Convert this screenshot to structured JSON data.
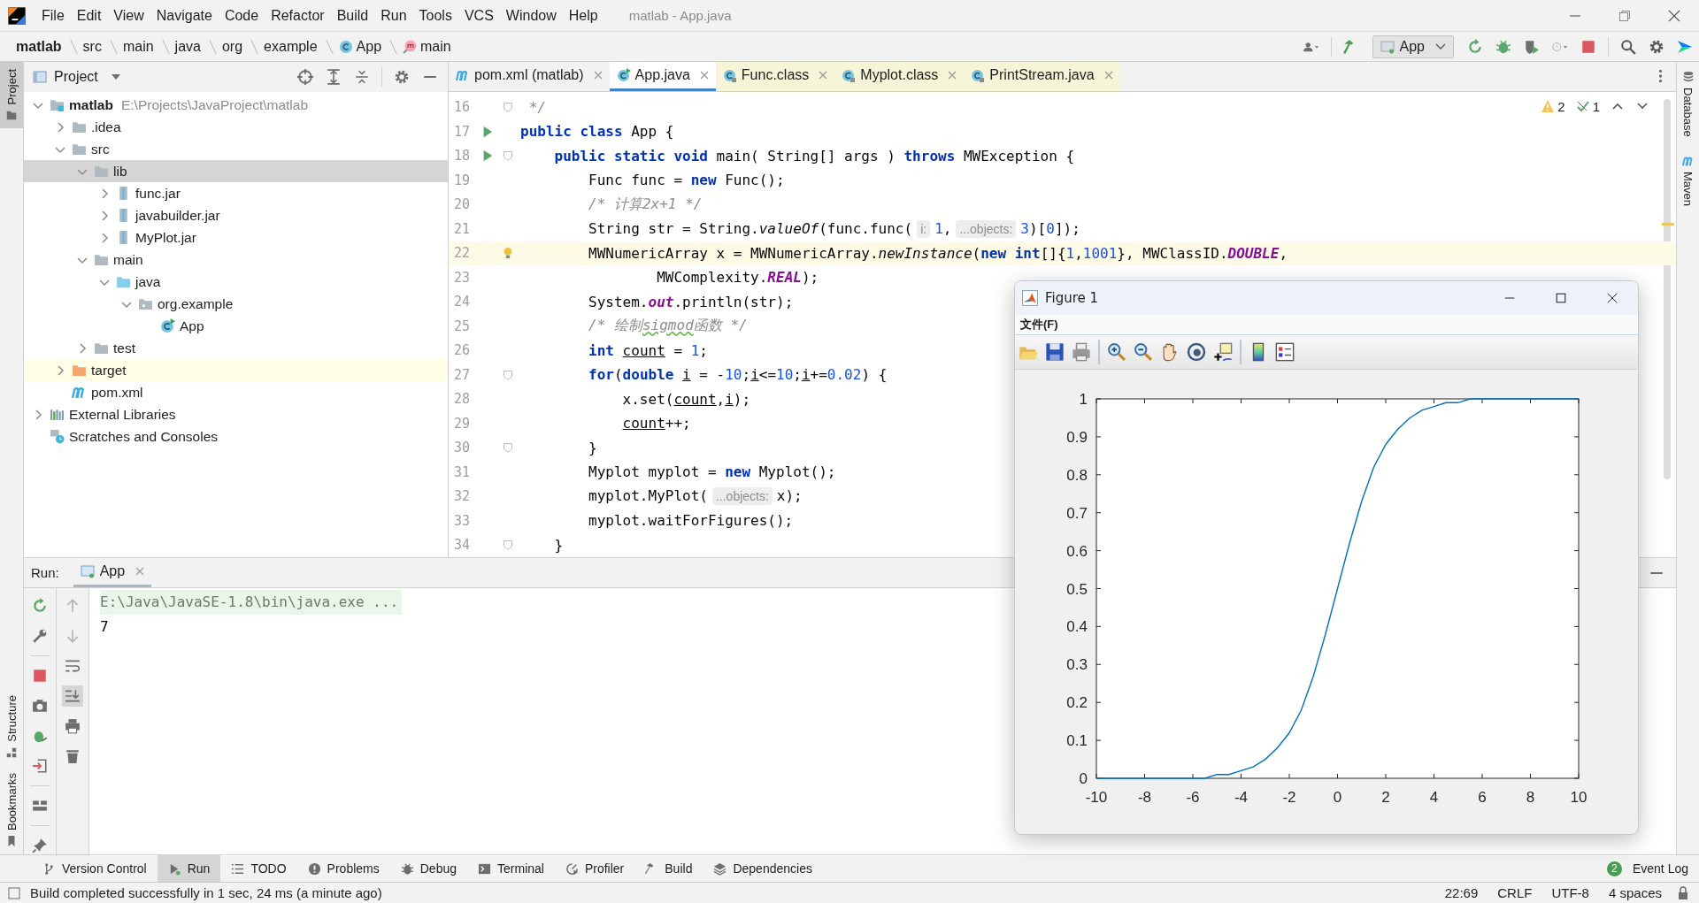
{
  "window": {
    "title": "matlab - App.java"
  },
  "menu": [
    "File",
    "Edit",
    "View",
    "Navigate",
    "Code",
    "Refactor",
    "Build",
    "Run",
    "Tools",
    "VCS",
    "Window",
    "Help"
  ],
  "breadcrumbs": [
    {
      "label": "matlab",
      "kind": "project"
    },
    {
      "label": "src",
      "kind": "folder"
    },
    {
      "label": "main",
      "kind": "folder"
    },
    {
      "label": "java",
      "kind": "folder"
    },
    {
      "label": "org",
      "kind": "folder"
    },
    {
      "label": "example",
      "kind": "folder"
    },
    {
      "label": "App",
      "kind": "class"
    },
    {
      "label": "main",
      "kind": "method"
    }
  ],
  "run_config": {
    "label": "App"
  },
  "left_strip": {
    "top": [
      {
        "label": "Project",
        "kind": "project",
        "selected": true
      }
    ],
    "bottom": [
      {
        "label": "Structure",
        "kind": "structure",
        "selected": false
      },
      {
        "label": "Bookmarks",
        "kind": "bookmarks",
        "selected": false
      }
    ]
  },
  "right_strip": [
    {
      "label": "Database",
      "kind": "database"
    },
    {
      "label": "Maven",
      "kind": "maven"
    }
  ],
  "project": {
    "title": "Project",
    "tree": [
      {
        "label": "matlab",
        "path": "E:\\Projects\\JavaProject\\matlab",
        "kind": "module",
        "expanded": true,
        "selected": false,
        "children": [
          {
            "label": ".idea",
            "kind": "folder",
            "expanded": false,
            "selected": false
          },
          {
            "label": "src",
            "kind": "folder",
            "expanded": true,
            "selected": false,
            "children": [
              {
                "label": "lib",
                "kind": "folder",
                "expanded": true,
                "selected": true,
                "children": [
                  {
                    "label": "func.jar",
                    "kind": "jar",
                    "expanded": false,
                    "selected": false
                  },
                  {
                    "label": "javabuilder.jar",
                    "kind": "jar",
                    "expanded": false,
                    "selected": false
                  },
                  {
                    "label": "MyPlot.jar",
                    "kind": "jar",
                    "expanded": false,
                    "selected": false
                  }
                ]
              },
              {
                "label": "main",
                "kind": "folder",
                "expanded": true,
                "selected": false,
                "children": [
                  {
                    "label": "java",
                    "kind": "source-folder",
                    "expanded": true,
                    "selected": false,
                    "children": [
                      {
                        "label": "org.example",
                        "kind": "package",
                        "expanded": true,
                        "selected": false,
                        "children": [
                          {
                            "label": "App",
                            "kind": "runnable-class",
                            "selected": false
                          }
                        ]
                      }
                    ]
                  }
                ]
              },
              {
                "label": "test",
                "kind": "folder",
                "expanded": false,
                "selected": false
              }
            ]
          },
          {
            "label": "target",
            "kind": "excluded-folder",
            "expanded": false,
            "selected": false
          },
          {
            "label": "pom.xml",
            "kind": "maven",
            "selected": false
          }
        ]
      },
      {
        "label": "External Libraries",
        "kind": "libraries",
        "expanded": false,
        "selected": false
      },
      {
        "label": "Scratches and Consoles",
        "kind": "scratches",
        "selected": false
      }
    ]
  },
  "editor": {
    "tabs": [
      {
        "label": "pom.xml (matlab)",
        "kind": "maven",
        "selected": false
      },
      {
        "label": "App.java",
        "kind": "project-class",
        "selected": true
      },
      {
        "label": "Func.class",
        "kind": "library-class",
        "selected": false
      },
      {
        "label": "Myplot.class",
        "kind": "library-class",
        "selected": false
      },
      {
        "label": "PrintStream.java",
        "kind": "library-class",
        "selected": false
      }
    ],
    "inspections": {
      "warnings": "2",
      "weak_warnings": "1"
    },
    "lines": [
      {
        "number": "16",
        "run": false,
        "fold": true,
        "bulb": false,
        "highlighted": false,
        "tokens": [
          {
            "kind": "comment",
            "text": " */"
          }
        ]
      },
      {
        "number": "17",
        "run": true,
        "fold": false,
        "bulb": false,
        "highlighted": false,
        "tokens": [
          {
            "kind": "keyword",
            "text": "public class"
          },
          {
            "kind": "plain",
            "text": " App {"
          }
        ]
      },
      {
        "number": "18",
        "run": true,
        "fold": true,
        "bulb": false,
        "highlighted": false,
        "tokens": [
          {
            "kind": "keyword",
            "text": "    public static void"
          },
          {
            "kind": "plain",
            "text": " main( String[] args ) "
          },
          {
            "kind": "keyword",
            "text": "throws"
          },
          {
            "kind": "plain",
            "text": " MWException {"
          }
        ]
      },
      {
        "number": "19",
        "run": false,
        "fold": false,
        "bulb": false,
        "highlighted": false,
        "tokens": [
          {
            "kind": "plain",
            "text": "        Func func = "
          },
          {
            "kind": "keyword",
            "text": "new"
          },
          {
            "kind": "plain",
            "text": " Func();"
          }
        ]
      },
      {
        "number": "20",
        "run": false,
        "fold": false,
        "bulb": false,
        "highlighted": false,
        "tokens": [
          {
            "kind": "comment",
            "text": "        /* 计算2x+1 */"
          }
        ]
      },
      {
        "number": "21",
        "run": false,
        "fold": false,
        "bulb": false,
        "highlighted": false,
        "tokens": [
          {
            "kind": "plain",
            "text": "        String str = String."
          },
          {
            "kind": "static-method",
            "text": "valueOf"
          },
          {
            "kind": "plain",
            "text": "(func.func("
          },
          {
            "kind": "hint",
            "text": "i:"
          },
          {
            "kind": "number",
            "text": "1"
          },
          {
            "kind": "plain",
            "text": ","
          },
          {
            "kind": "hint",
            "text": "...objects:"
          },
          {
            "kind": "number",
            "text": "3"
          },
          {
            "kind": "plain",
            "text": ")["
          },
          {
            "kind": "number",
            "text": "0"
          },
          {
            "kind": "plain",
            "text": "]);"
          }
        ]
      },
      {
        "number": "22",
        "run": false,
        "fold": false,
        "bulb": true,
        "highlighted": true,
        "tokens": [
          {
            "kind": "plain",
            "text": "        MWNumericArray x = MWNumericArray."
          },
          {
            "kind": "static-method",
            "text": "newInstance"
          },
          {
            "kind": "plain",
            "text": "("
          },
          {
            "kind": "keyword",
            "text": "new int"
          },
          {
            "kind": "plain",
            "text": "[]{"
          },
          {
            "kind": "number",
            "text": "1"
          },
          {
            "kind": "plain",
            "text": ","
          },
          {
            "kind": "number",
            "text": "1001"
          },
          {
            "kind": "plain",
            "text": "}, MWClassID."
          },
          {
            "kind": "static-field",
            "text": "DOUBLE"
          },
          {
            "kind": "plain",
            "text": ","
          }
        ]
      },
      {
        "number": "23",
        "run": false,
        "fold": false,
        "bulb": false,
        "highlighted": false,
        "tokens": [
          {
            "kind": "plain",
            "text": "                MWComplexity."
          },
          {
            "kind": "static-field",
            "text": "REAL"
          },
          {
            "kind": "plain",
            "text": ");"
          }
        ]
      },
      {
        "number": "24",
        "run": false,
        "fold": false,
        "bulb": false,
        "highlighted": false,
        "tokens": [
          {
            "kind": "plain",
            "text": "        System."
          },
          {
            "kind": "static-field",
            "text": "out"
          },
          {
            "kind": "plain",
            "text": ".println(str);"
          }
        ]
      },
      {
        "number": "25",
        "run": false,
        "fold": false,
        "bulb": false,
        "highlighted": false,
        "tokens": [
          {
            "kind": "comment",
            "text": "        /* 绘制"
          },
          {
            "kind": "comment-typo",
            "text": "sigmod"
          },
          {
            "kind": "comment",
            "text": "函数 */"
          }
        ]
      },
      {
        "number": "26",
        "run": false,
        "fold": false,
        "bulb": false,
        "highlighted": false,
        "tokens": [
          {
            "kind": "keyword",
            "text": "        int"
          },
          {
            "kind": "variable",
            "text": " count"
          },
          {
            "kind": "plain",
            "text": " = "
          },
          {
            "kind": "number",
            "text": "1"
          },
          {
            "kind": "plain",
            "text": ";"
          }
        ]
      },
      {
        "number": "27",
        "run": false,
        "fold": true,
        "bulb": false,
        "highlighted": false,
        "tokens": [
          {
            "kind": "keyword",
            "text": "        for"
          },
          {
            "kind": "plain",
            "text": "("
          },
          {
            "kind": "keyword",
            "text": "double"
          },
          {
            "kind": "variable",
            "text": " i"
          },
          {
            "kind": "plain",
            "text": " = -"
          },
          {
            "kind": "number",
            "text": "10"
          },
          {
            "kind": "plain",
            "text": ";"
          },
          {
            "kind": "variable",
            "text": "i"
          },
          {
            "kind": "plain",
            "text": "<="
          },
          {
            "kind": "number",
            "text": "10"
          },
          {
            "kind": "plain",
            "text": ";"
          },
          {
            "kind": "variable",
            "text": "i"
          },
          {
            "kind": "plain",
            "text": "+="
          },
          {
            "kind": "number",
            "text": "0.02"
          },
          {
            "kind": "plain",
            "text": ") {"
          }
        ]
      },
      {
        "number": "28",
        "run": false,
        "fold": false,
        "bulb": false,
        "highlighted": false,
        "tokens": [
          {
            "kind": "plain",
            "text": "            x.set("
          },
          {
            "kind": "variable",
            "text": "count"
          },
          {
            "kind": "plain",
            "text": ","
          },
          {
            "kind": "variable",
            "text": "i"
          },
          {
            "kind": "plain",
            "text": ");"
          }
        ]
      },
      {
        "number": "29",
        "run": false,
        "fold": false,
        "bulb": false,
        "highlighted": false,
        "tokens": [
          {
            "kind": "variable",
            "text": "            count"
          },
          {
            "kind": "plain",
            "text": "++;"
          }
        ]
      },
      {
        "number": "30",
        "run": false,
        "fold": true,
        "bulb": false,
        "highlighted": false,
        "tokens": [
          {
            "kind": "plain",
            "text": "        }"
          }
        ]
      },
      {
        "number": "31",
        "run": false,
        "fold": false,
        "bulb": false,
        "highlighted": false,
        "tokens": [
          {
            "kind": "plain",
            "text": "        Myplot myplot = "
          },
          {
            "kind": "keyword",
            "text": "new"
          },
          {
            "kind": "plain",
            "text": " Myplot();"
          }
        ]
      },
      {
        "number": "32",
        "run": false,
        "fold": false,
        "bulb": false,
        "highlighted": false,
        "tokens": [
          {
            "kind": "plain",
            "text": "        myplot.MyPlot("
          },
          {
            "kind": "hint",
            "text": "...objects:"
          },
          {
            "kind": "plain",
            "text": "x);"
          }
        ]
      },
      {
        "number": "33",
        "run": false,
        "fold": false,
        "bulb": false,
        "highlighted": false,
        "tokens": [
          {
            "kind": "plain",
            "text": "        myplot.waitForFigures();"
          }
        ]
      },
      {
        "number": "34",
        "run": false,
        "fold": true,
        "bulb": false,
        "highlighted": false,
        "tokens": [
          {
            "kind": "plain",
            "text": "    }"
          }
        ]
      }
    ]
  },
  "run": {
    "label": "Run:",
    "tab": "App",
    "console": [
      {
        "kind": "command",
        "text": "E:\\Java\\JavaSE-1.8\\bin\\java.exe ..."
      },
      {
        "kind": "output",
        "text": "7"
      }
    ]
  },
  "bottom_tabs": [
    {
      "label": "Version Control",
      "kind": "vcs",
      "selected": false
    },
    {
      "label": "Run",
      "kind": "run",
      "selected": true
    },
    {
      "label": "TODO",
      "kind": "todo",
      "selected": false
    },
    {
      "label": "Problems",
      "kind": "problems",
      "selected": false
    },
    {
      "label": "Debug",
      "kind": "debug",
      "selected": false
    },
    {
      "label": "Terminal",
      "kind": "terminal",
      "selected": false
    },
    {
      "label": "Profiler",
      "kind": "profiler",
      "selected": false
    },
    {
      "label": "Build",
      "kind": "build",
      "selected": false
    },
    {
      "label": "Dependencies",
      "kind": "dependencies",
      "selected": false
    }
  ],
  "event_log": {
    "label": "Event Log",
    "count": "2"
  },
  "status": {
    "message": "Build completed successfully in 1 sec, 24 ms (a minute ago)",
    "items": [
      "22:69",
      "CRLF",
      "UTF-8",
      "4 spaces"
    ]
  },
  "figure": {
    "title": "Figure 1",
    "menu": [
      "文件(F)"
    ],
    "chart_data": {
      "type": "line",
      "x": [
        -10,
        -9.5,
        -9,
        -8.5,
        -8,
        -7.5,
        -7,
        -6.5,
        -6,
        -5.5,
        -5,
        -4.5,
        -4,
        -3.5,
        -3,
        -2.5,
        -2,
        -1.5,
        -1,
        -0.5,
        0,
        0.5,
        1,
        1.5,
        2,
        2.5,
        3,
        3.5,
        4,
        4.5,
        5,
        5.5,
        6,
        6.5,
        7,
        7.5,
        8,
        8.5,
        9,
        9.5,
        10
      ],
      "series": [
        {
          "color": "#0072bd",
          "values": [
            0,
            0,
            0,
            0,
            0,
            0,
            0,
            0,
            0,
            0,
            0.01,
            0.01,
            0.02,
            0.03,
            0.05,
            0.08,
            0.12,
            0.18,
            0.27,
            0.38,
            0.5,
            0.62,
            0.73,
            0.82,
            0.88,
            0.92,
            0.95,
            0.97,
            0.98,
            0.99,
            0.99,
            1,
            1,
            1,
            1,
            1,
            1,
            1,
            1,
            1,
            1
          ]
        }
      ],
      "xlim": [
        -10,
        10
      ],
      "ylim": [
        0,
        1
      ],
      "xticks": [
        -10,
        -8,
        -6,
        -4,
        -2,
        0,
        2,
        4,
        6,
        8,
        10
      ],
      "yticks": [
        0,
        0.1,
        0.2,
        0.3,
        0.4,
        0.5,
        0.6,
        0.7,
        0.8,
        0.9,
        1
      ]
    }
  }
}
